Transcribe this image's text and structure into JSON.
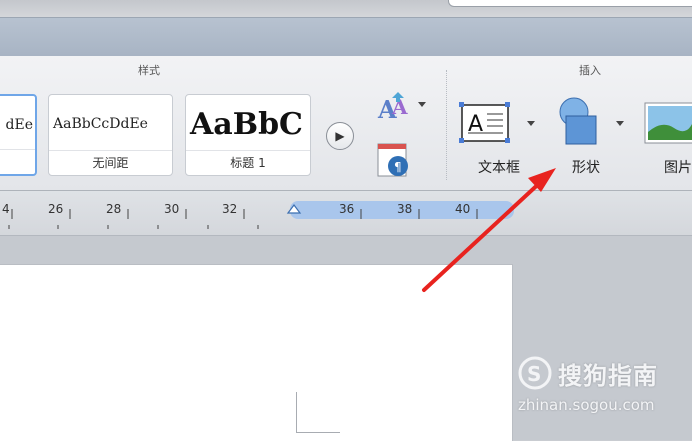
{
  "ribbon": {
    "styles_group_label": "样式",
    "insert_group_label": "插入",
    "style_tiles": [
      {
        "preview": "dEe",
        "name": ""
      },
      {
        "preview": "AaBbCcDdEe",
        "name": "无间距"
      },
      {
        "preview": "AaBbC",
        "name": "标题 1"
      }
    ],
    "insert_buttons": [
      {
        "label": "文本框"
      },
      {
        "label": "形状"
      },
      {
        "label": "图片"
      }
    ]
  },
  "ruler": {
    "numbers": [
      "4",
      "26",
      "28",
      "30",
      "32",
      "36",
      "38",
      "40"
    ]
  },
  "annotation": {
    "arrow_color": "#e8231f"
  },
  "watermark": {
    "brand": "搜狗指南",
    "url": "zhinan.sogou.com"
  },
  "colors": {
    "selected_tile_border": "#6fa6e8",
    "ruler_highlight": "#a9c6ec"
  }
}
